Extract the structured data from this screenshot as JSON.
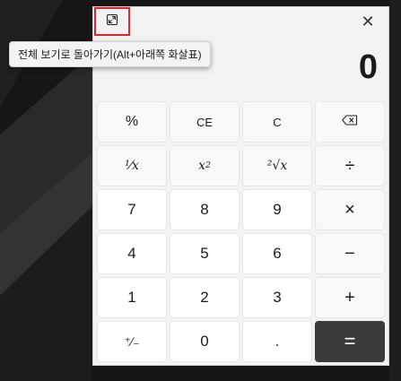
{
  "window": {
    "restore_tooltip": "전체 보기로 돌아가기(Alt+아래쪽 화살표)",
    "close_glyph": "✕"
  },
  "display": {
    "value": "0"
  },
  "keys": {
    "percent": "%",
    "clear_entry": "CE",
    "clear": "C",
    "backspace_glyph": "⌫",
    "reciprocal": "¹⁄x",
    "square_base": "x",
    "square_exp": "2",
    "sqrt": "²√x",
    "divide": "÷",
    "seven": "7",
    "eight": "8",
    "nine": "9",
    "multiply": "×",
    "four": "4",
    "five": "5",
    "six": "6",
    "minus": "−",
    "one": "1",
    "two": "2",
    "three": "3",
    "plus": "+",
    "negate": "⁺∕₋",
    "zero": "0",
    "decimal": ".",
    "equals": "="
  },
  "colors": {
    "highlight_border": "#e02434",
    "equals_bg": "#3b3b3b"
  }
}
